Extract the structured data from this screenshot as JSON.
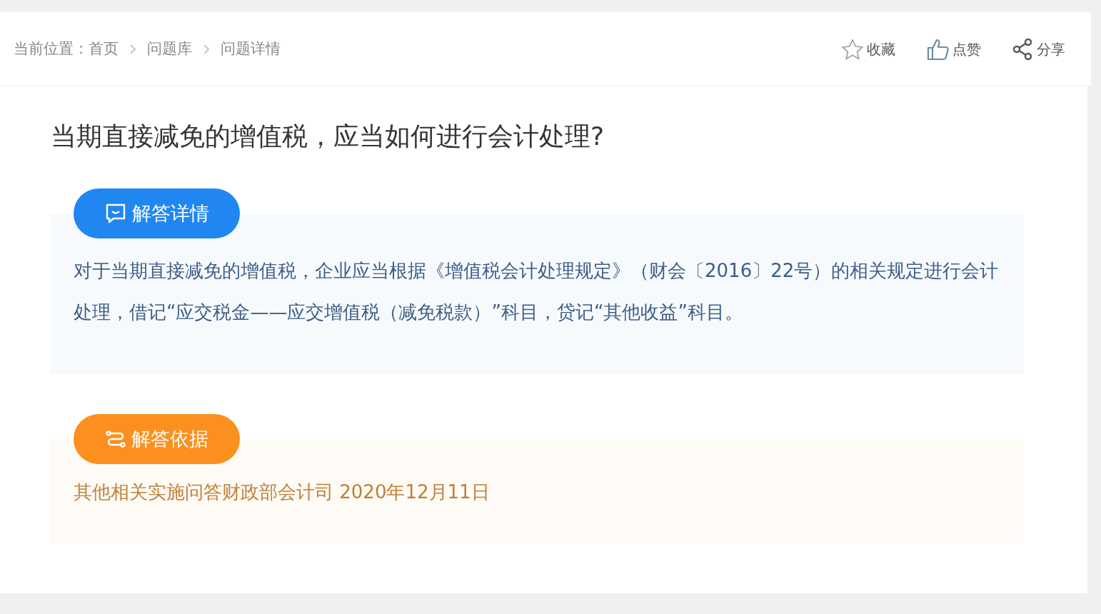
{
  "breadcrumb": {
    "label": "当前位置：",
    "items": [
      {
        "text": "首页"
      },
      {
        "text": "问题库"
      },
      {
        "text": "问题详情"
      }
    ]
  },
  "actions": [
    {
      "kind": "star",
      "label": "收藏"
    },
    {
      "kind": "thumb",
      "label": "点赞"
    },
    {
      "kind": "share",
      "label": "分享"
    }
  ],
  "title": "当期直接减免的增值税，应当如何进行会计处理?",
  "sections": [
    {
      "kind": "detail",
      "heading": "解答详情",
      "text": "对于当期直接减免的增值税，企业应当根据《增值税会计处理规定》（财会〔2016〕22号）的相关规定进行会计处理，借记“应交税金——应交增值税（减免税款）”科目，贷记“其他收益”科目。"
    },
    {
      "kind": "basis",
      "heading": "解答依据",
      "text": "其他相关实施问答财政部会计司 2020年12月11日"
    }
  ]
}
